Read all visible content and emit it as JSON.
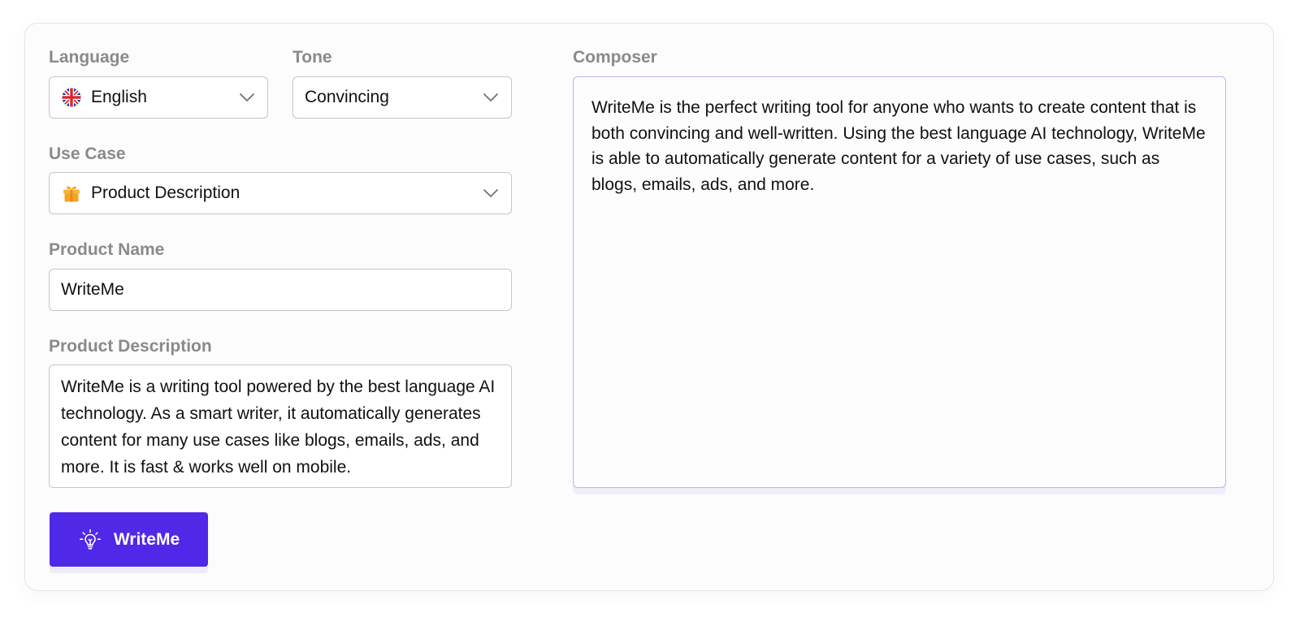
{
  "form": {
    "language": {
      "label": "Language",
      "value": "English",
      "icon": "uk-flag-icon"
    },
    "tone": {
      "label": "Tone",
      "value": "Convincing"
    },
    "use_case": {
      "label": "Use Case",
      "value": "Product Description",
      "icon": "gift-icon"
    },
    "product_name": {
      "label": "Product Name",
      "value": "WriteMe"
    },
    "product_description": {
      "label": "Product Description",
      "value": "WriteMe is a writing tool powered by the best language AI technology. As a smart writer, it automatically generates content for many use cases like blogs, emails, ads, and more. It is fast & works well on mobile."
    },
    "submit": {
      "label": "WriteMe",
      "icon": "lightbulb-icon"
    }
  },
  "composer": {
    "label": "Composer",
    "text": "WriteMe is the perfect writing tool for anyone who wants to create content that is both convincing and well-written. Using the best language AI technology, WriteMe is able to automatically generate content for a variety of use cases, such as blogs, emails, ads, and more."
  },
  "colors": {
    "accent": "#5028e8",
    "label": "#8a8a8a",
    "border": "#c6c6c6",
    "composer_border": "#b9b6ef"
  }
}
